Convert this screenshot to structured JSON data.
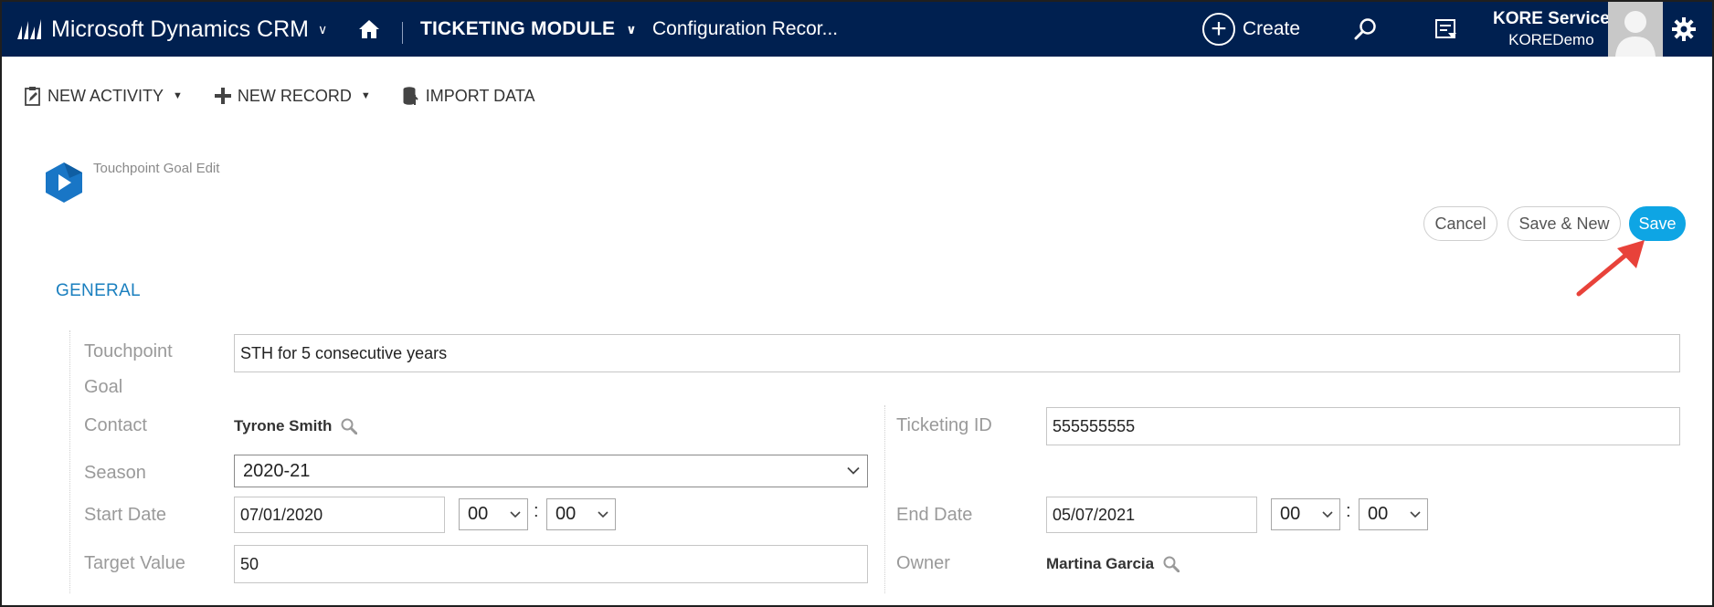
{
  "topbar": {
    "app_title": "Microsoft Dynamics CRM",
    "module": "TICKETING MODULE",
    "breadcrumb": "Configuration Recor...",
    "create_label": "Create",
    "user_name": "KORE Service",
    "user_org": "KOREDemo",
    "background_color": "#002050"
  },
  "commandbar": {
    "new_activity": "NEW ACTIVITY",
    "new_record": "NEW RECORD",
    "import_data": "IMPORT DATA"
  },
  "entity": {
    "title": "Touchpoint Goal Edit"
  },
  "actions": {
    "cancel": "Cancel",
    "save_new": "Save & New",
    "save": "Save",
    "save_color": "#0ea5e4"
  },
  "form": {
    "section_title": "GENERAL",
    "touchpoint_goal_label_1": "Touchpoint",
    "touchpoint_goal_label_2": "Goal",
    "touchpoint_goal_value": "STH for 5 consecutive years",
    "contact_label": "Contact",
    "contact_value": "Tyrone Smith",
    "ticketing_id_label": "Ticketing ID",
    "ticketing_id_value": "555555555",
    "season_label": "Season",
    "season_value": "2020-21",
    "start_date_label": "Start Date",
    "start_date_value": "07/01/2020",
    "start_hour": "00",
    "start_minute": "00",
    "end_date_label": "End Date",
    "end_date_value": "05/07/2021",
    "end_hour": "00",
    "end_minute": "00",
    "time_separator": ":",
    "target_value_label": "Target Value",
    "target_value_value": "50",
    "owner_label": "Owner",
    "owner_value": "Martina Garcia"
  },
  "icons": {
    "logo": "dynamics-logo-icon",
    "home": "home-icon",
    "search": "search-icon",
    "tasks": "task-list-icon",
    "settings": "gear-icon",
    "entity": "touchpoint-entity-icon",
    "annotation_arrow_color": "#e8423a"
  }
}
